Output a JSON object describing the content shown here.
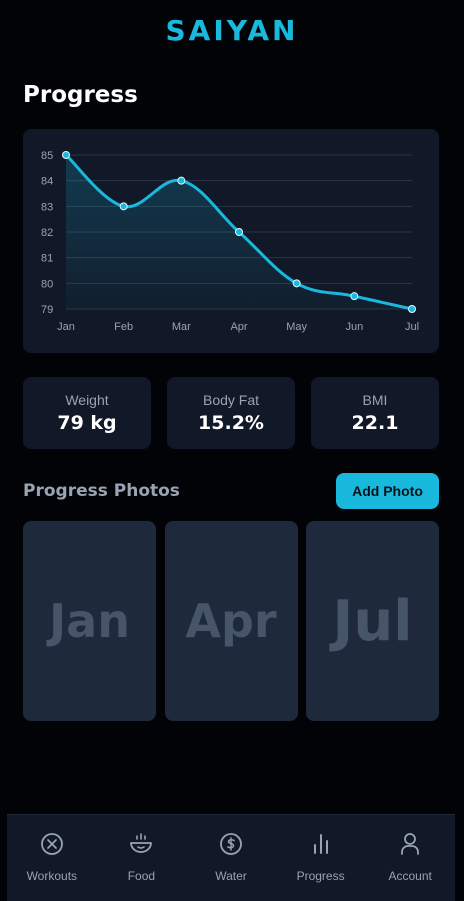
{
  "header": {
    "title": "SAIYAN"
  },
  "page": {
    "title": "Progress"
  },
  "chart_data": {
    "type": "line",
    "categories": [
      "Jan",
      "Feb",
      "Mar",
      "Apr",
      "May",
      "Jun",
      "Jul"
    ],
    "series": [
      {
        "values": [
          85,
          83,
          84,
          82,
          80,
          79.5,
          79
        ]
      }
    ],
    "y_ticks": [
      "85",
      "84",
      "83",
      "82",
      "81",
      "80",
      "79"
    ],
    "ylim": [
      79,
      85
    ],
    "title": "",
    "xlabel": "",
    "ylabel": "",
    "grid": true,
    "smooth": true,
    "area_fill": true,
    "line_color": "#19b8dd"
  },
  "stats": [
    {
      "label": "Weight",
      "value": "79 kg"
    },
    {
      "label": "Body Fat",
      "value": "15.2%"
    },
    {
      "label": "BMI",
      "value": "22.1"
    }
  ],
  "photos": {
    "title": "Progress Photos",
    "add_label": "Add Photo",
    "items": [
      "Jan",
      "Apr",
      "Jul"
    ]
  },
  "nav": {
    "items": [
      {
        "label": "Workouts",
        "icon": "workouts-icon"
      },
      {
        "label": "Food",
        "icon": "food-icon"
      },
      {
        "label": "Water",
        "icon": "water-icon"
      },
      {
        "label": "Progress",
        "icon": "progress-icon"
      },
      {
        "label": "Account",
        "icon": "account-icon"
      }
    ]
  },
  "colors": {
    "accent": "#19b8dd",
    "background": "#020306",
    "card": "#111827",
    "muted_text": "#9aa3b2"
  }
}
